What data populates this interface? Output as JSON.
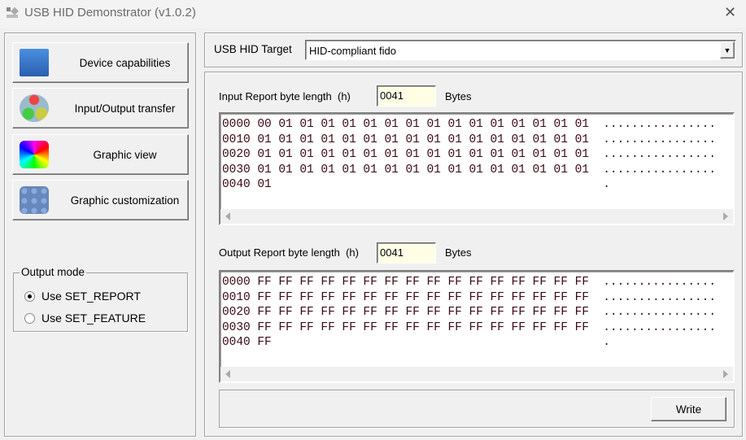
{
  "window": {
    "title": "USB HID Demonstrator (v1.0.2)"
  },
  "nav": [
    {
      "label": "Device capabilities",
      "icon": "device-capabilities-icon"
    },
    {
      "label": "Input/Output transfer",
      "icon": "io-transfer-icon"
    },
    {
      "label": "Graphic view",
      "icon": "graphic-view-icon"
    },
    {
      "label": "Graphic customization",
      "icon": "graphic-customization-icon"
    }
  ],
  "output_mode": {
    "legend": "Output mode",
    "options": [
      {
        "label": "Use SET_REPORT",
        "selected": true
      },
      {
        "label": "Use SET_FEATURE",
        "selected": false
      }
    ]
  },
  "target": {
    "label": "USB HID Target",
    "value": "HID-compliant fido"
  },
  "input": {
    "label": "Input Report byte length  (h)",
    "length": "0041",
    "unit": "Bytes",
    "rows": [
      "0000 00 01 01 01 01 01 01 01 01 01 01 01 01 01 01 01  ................",
      "0010 01 01 01 01 01 01 01 01 01 01 01 01 01 01 01 01  ................",
      "0020 01 01 01 01 01 01 01 01 01 01 01 01 01 01 01 01  ................",
      "0030 01 01 01 01 01 01 01 01 01 01 01 01 01 01 01 01  ................",
      "0040 01                                               ."
    ]
  },
  "output": {
    "label": "Output Report byte length  (h)",
    "length": "0041",
    "unit": "Bytes",
    "rows": [
      "0000 FF FF FF FF FF FF FF FF FF FF FF FF FF FF FF FF  ................",
      "0010 FF FF FF FF FF FF FF FF FF FF FF FF FF FF FF FF  ................",
      "0020 FF FF FF FF FF FF FF FF FF FF FF FF FF FF FF FF  ................",
      "0030 FF FF FF FF FF FF FF FF FF FF FF FF FF FF FF FF  ................",
      "0040 FF                                               ."
    ]
  },
  "write_label": "Write"
}
